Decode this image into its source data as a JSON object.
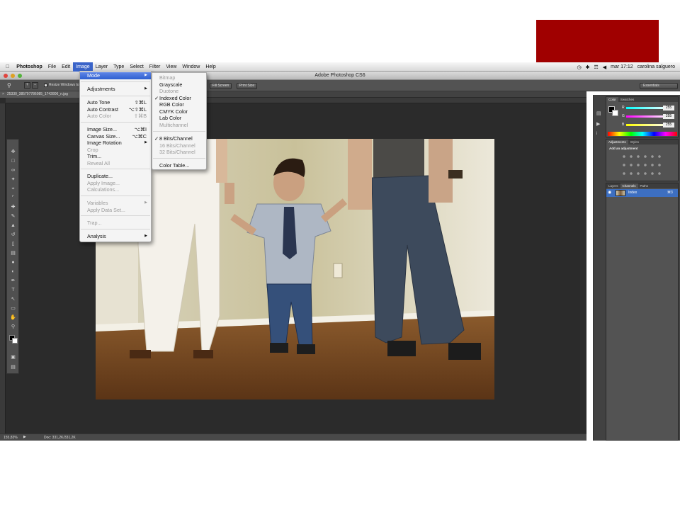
{
  "menubar": {
    "items": [
      "Photoshop",
      "File",
      "Edit",
      "Image",
      "Layer",
      "Type",
      "Select",
      "Filter",
      "View",
      "Window",
      "Help"
    ],
    "clock": "mar 17:12",
    "user": "carolina salguero"
  },
  "window": {
    "title": "Adobe Photoshop CS6"
  },
  "options": {
    "resize_label": "Resize Windows to",
    "fill_screen": "Fill Screen",
    "print_size": "Print Size",
    "workspace": "Essentials"
  },
  "document": {
    "tab": "25330_385797786085_1742806_n.jpg"
  },
  "status": {
    "zoom": "155,83%",
    "doc": "Doc: 331,2K/331,2K"
  },
  "image_menu": {
    "mode": "Mode",
    "adjustments": "Adjustments",
    "auto_tone": "Auto Tone",
    "auto_tone_sc": "⇧⌘L",
    "auto_contrast": "Auto Contrast",
    "auto_contrast_sc": "⌥⇧⌘L",
    "auto_color": "Auto Color",
    "auto_color_sc": "⇧⌘B",
    "image_size": "Image Size...",
    "image_size_sc": "⌥⌘I",
    "canvas_size": "Canvas Size...",
    "canvas_size_sc": "⌥⌘C",
    "image_rotation": "Image Rotation",
    "crop": "Crop",
    "trim": "Trim...",
    "reveal_all": "Reveal All",
    "duplicate": "Duplicate...",
    "apply_image": "Apply Image...",
    "calculations": "Calculations...",
    "variables": "Variables",
    "apply_data_set": "Apply Data Set...",
    "trap": "Trap...",
    "analysis": "Analysis"
  },
  "mode_menu": {
    "bitmap": "Bitmap",
    "grayscale": "Grayscale",
    "duotone": "Duotone",
    "indexed": "Indexed Color",
    "rgb": "RGB Color",
    "cmyk": "CMYK Color",
    "lab": "Lab Color",
    "multichannel": "Multichannel",
    "bits8": "8 Bits/Channel",
    "bits16": "16 Bits/Channel",
    "bits32": "32 Bits/Channel",
    "color_table": "Color Table...",
    "check": "✓"
  },
  "color_panel": {
    "tabs": [
      "Color",
      "Swatches"
    ],
    "channels": [
      {
        "label": "R",
        "value": "255"
      },
      {
        "label": "G",
        "value": "255"
      },
      {
        "label": "B",
        "value": "255"
      }
    ]
  },
  "adjustments_panel": {
    "tabs": [
      "Adjustments",
      "Styles"
    ],
    "hint": "Add an adjustment"
  },
  "layers_panel": {
    "tabs": [
      "Layers",
      "Channels",
      "Paths"
    ],
    "channel_name": "Index",
    "channel_shortcut": "⌘3"
  },
  "colors": {
    "accent_block": "#a00000",
    "menu_highlight": "#3a64c9"
  }
}
